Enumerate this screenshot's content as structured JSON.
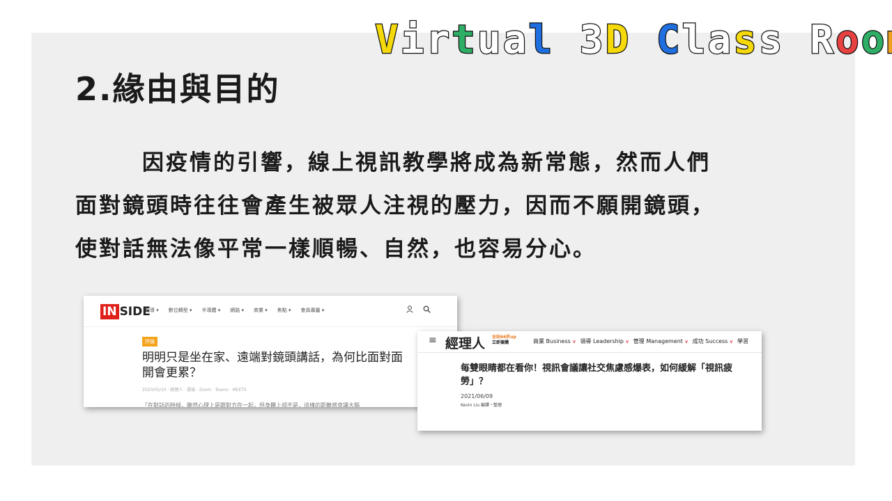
{
  "brand": {
    "letters": [
      {
        "ch": "V",
        "color": "#f5d90a"
      },
      {
        "ch": "i",
        "color": "#ffffff"
      },
      {
        "ch": "r",
        "color": "#ffffff"
      },
      {
        "ch": "t",
        "color": "#2fae66"
      },
      {
        "ch": "u",
        "color": "#ffffff"
      },
      {
        "ch": "a",
        "color": "#ffffff"
      },
      {
        "ch": "l",
        "color": "#1f6fe0"
      },
      {
        "ch": " ",
        "color": "#ffffff"
      },
      {
        "ch": "3",
        "color": "#ffffff"
      },
      {
        "ch": "D",
        "color": "#f5d90a"
      },
      {
        "ch": " ",
        "color": "#ffffff"
      },
      {
        "ch": "C",
        "color": "#1f6fe0"
      },
      {
        "ch": "l",
        "color": "#ffffff"
      },
      {
        "ch": "a",
        "color": "#ffffff"
      },
      {
        "ch": "s",
        "color": "#f5d90a"
      },
      {
        "ch": "s",
        "color": "#ffffff"
      },
      {
        "ch": " ",
        "color": "#ffffff"
      },
      {
        "ch": "R",
        "color": "#ffffff"
      },
      {
        "ch": "o",
        "color": "#e84141"
      },
      {
        "ch": "o",
        "color": "#2fae66"
      },
      {
        "ch": "m",
        "color": "#f0a020"
      }
    ]
  },
  "slide": {
    "title": "2.緣由與目的",
    "body_lines": [
      "因疫情的引響，線上視訊教學將成為新常態，然而人們",
      "面對鏡頭時往往會產生被眾人注視的壓力，因而不願開鏡頭，",
      "使對話無法像平常一樣順暢、自然，也容易分心。"
    ]
  },
  "screenshot1": {
    "logo_in": "IN",
    "logo_rest": "SIDE",
    "menu": [
      "報導 ▾",
      "數位轉型 ▾",
      "半導體 ▾",
      "網路 ▾",
      "商業 ▾",
      "焦點 ▾",
      "會員專屬 ▾"
    ],
    "icons": [
      "user-icon",
      "search-icon"
    ],
    "user_glyph": "⚲",
    "search_glyph": "🔍",
    "badge": "評論",
    "headline": "明明只是坐在家、遠端對鏡頭講話，為何比面對面開會更累？",
    "meta": "2020/05/10 · 經理人 · 遠端 · Zoom · Teams · MEETS",
    "snippet": "「在對話的時候，雖然心理上是跟對方在一起，但身體上卻不是，這樣的距離感會讓大腦"
  },
  "screenshot2": {
    "burger": "≡",
    "logo": "經理人",
    "promo_line1": "全站66折up",
    "promo_line2": "立即搶購",
    "menu": [
      {
        "label": "商業 Business",
        "caret": "∨"
      },
      {
        "label": "領導 Leadership",
        "caret": "∨"
      },
      {
        "label": "管理 Management",
        "caret": "∨"
      },
      {
        "label": "成功 Success",
        "caret": "∨"
      },
      {
        "label": "學習",
        "caret": ""
      }
    ],
    "headline": "每雙眼睛都在看你！視訊會議讓社交焦慮感爆表，如何緩解「視訊疲勞」？",
    "date": "2021/06/09",
    "author": "Kevin Liu 編譯・整理"
  }
}
